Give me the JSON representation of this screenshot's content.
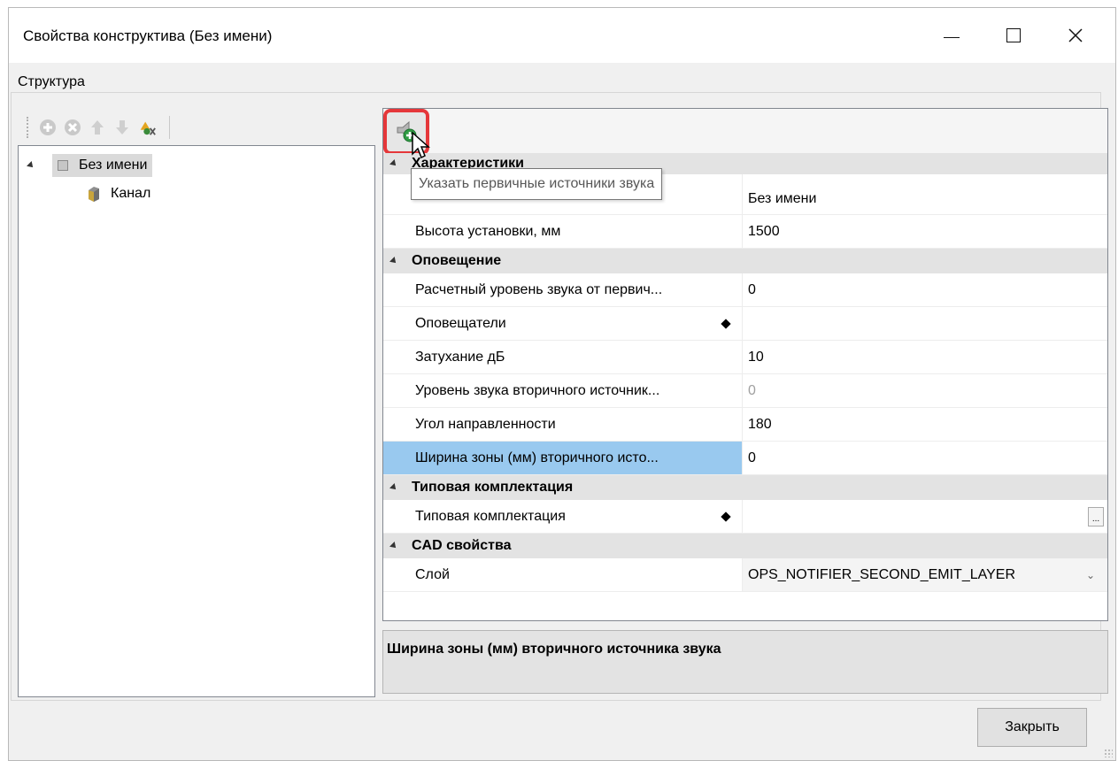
{
  "window": {
    "title": "Свойства конструктива (Без имени)"
  },
  "structure": {
    "group_label": "Структура",
    "tree": {
      "root": "Без имени",
      "child": "Канал"
    }
  },
  "toolbar": {
    "tooltip": "Указать первичные источники звука"
  },
  "properties": {
    "categories": [
      {
        "label": "Характеристики",
        "rows": [
          {
            "name": "",
            "value": "Без имени"
          },
          {
            "name": "Высота установки, мм",
            "value": "1500"
          }
        ]
      },
      {
        "label": "Оповещение",
        "rows": [
          {
            "name": "Расчетный уровень звука от первич...",
            "value": "0"
          },
          {
            "name": "Оповещатели",
            "value": ""
          },
          {
            "name": "Затухание дБ",
            "value": "10"
          },
          {
            "name": "Уровень звука вторичного источник...",
            "value": "0"
          },
          {
            "name": "Угол направленности",
            "value": "180"
          },
          {
            "name": "Ширина зоны (мм) вторичного исто...",
            "value": "0"
          }
        ]
      },
      {
        "label": "Типовая комплектация",
        "rows": [
          {
            "name": "Типовая комплектация",
            "value": "",
            "button": "..."
          }
        ]
      },
      {
        "label": "CAD свойства",
        "rows": [
          {
            "name": "Слой",
            "value": "OPS_NOTIFIER_SECOND_EMIT_LAYER"
          }
        ]
      }
    ]
  },
  "description": "Ширина зоны (мм) вторичного источника звука",
  "buttons": {
    "close": "Закрыть"
  }
}
